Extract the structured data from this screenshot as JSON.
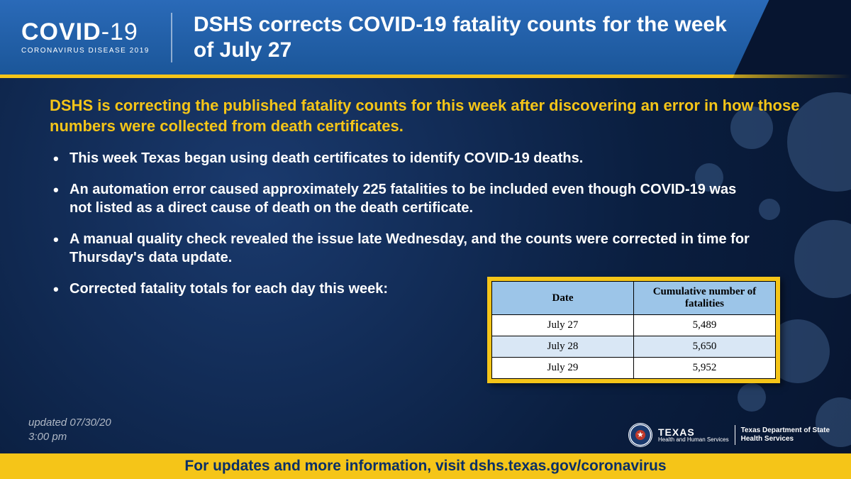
{
  "logo": {
    "main_a": "COVID",
    "main_b": "-19",
    "sub": "CORONAVIRUS DISEASE 2019"
  },
  "header": {
    "title": "DSHS corrects COVID-19 fatality counts for the week of July 27"
  },
  "lead": "DSHS is correcting the published fatality counts for this week after discovering an error in how those numbers were collected from death certificates.",
  "bullets": [
    "This week Texas began using death certificates to identify COVID-19 deaths.",
    "An automation error caused approximately 225 fatalities to be included even though COVID-19 was not listed as a direct cause of death on the death certificate.",
    "A manual quality check revealed the issue late Wednesday, and the counts were corrected in time for Thursday's data update.",
    "Corrected fatality totals for each day this week:"
  ],
  "table": {
    "headers": [
      "Date",
      "Cumulative number of fatalities"
    ],
    "rows": [
      [
        "July 27",
        "5,489"
      ],
      [
        "July 28",
        "5,650"
      ],
      [
        "July 29",
        "5,952"
      ]
    ]
  },
  "updated": {
    "line1": "updated 07/30/20",
    "line2": "3:00 pm"
  },
  "agency": {
    "state": "TEXAS",
    "dept1": "Health and Human Services",
    "dept2a": "Texas Department of State",
    "dept2b": "Health Services"
  },
  "footer": "For updates and more information, visit dshs.texas.gov/coronavirus"
}
